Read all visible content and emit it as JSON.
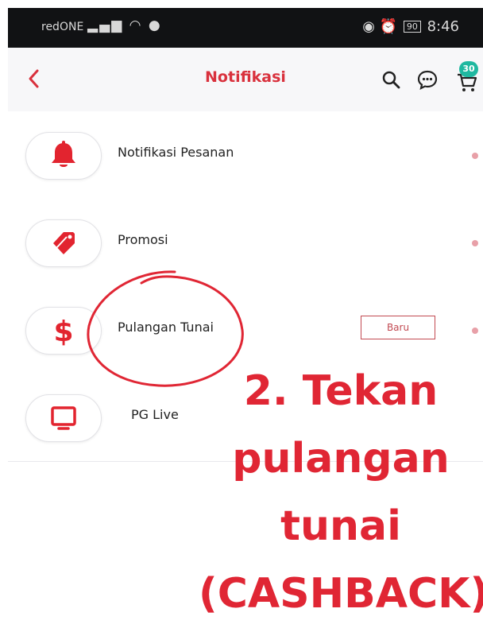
{
  "status_bar": {
    "carrier": "redONE",
    "battery": "90",
    "time": "8:46"
  },
  "header": {
    "title": "Notifikasi",
    "cart_count": "30"
  },
  "notifications": [
    {
      "label": "Notifikasi Pesanan",
      "icon": "bell-icon",
      "badge": ""
    },
    {
      "label": "Promosi",
      "icon": "tag-icon",
      "badge": ""
    },
    {
      "label": "Pulangan Tunai",
      "icon": "dollar-icon",
      "badge": "Baru"
    },
    {
      "label": "PG Live",
      "icon": "tv-icon",
      "badge": ""
    }
  ],
  "annotation": {
    "line1": "2. Tekan",
    "line2": "pulangan",
    "line3": "tunai",
    "line4": "(CASHBACK)"
  },
  "colors": {
    "accent": "#d9313d",
    "annotation": "#e02634",
    "cart_badge": "#1fb8a0"
  }
}
